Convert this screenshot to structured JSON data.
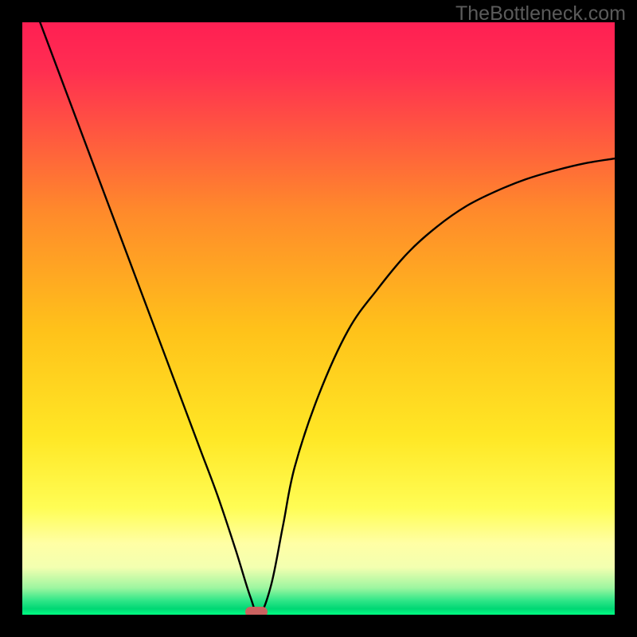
{
  "watermark": "TheBottleneck.com",
  "chart_data": {
    "type": "line",
    "title": "",
    "xlabel": "",
    "ylabel": "",
    "xlim": [
      0,
      100
    ],
    "ylim": [
      0,
      100
    ],
    "x": [
      3,
      6,
      9,
      12,
      15,
      18,
      21,
      24,
      27,
      30,
      33,
      36,
      38.5,
      40,
      42,
      44,
      46,
      50,
      55,
      60,
      65,
      70,
      75,
      80,
      85,
      90,
      95,
      100
    ],
    "values": [
      100,
      92,
      84,
      76,
      68,
      60,
      52,
      44,
      36,
      28,
      20,
      11,
      3,
      0,
      5,
      15,
      25,
      37,
      48,
      55,
      61,
      65.5,
      69,
      71.5,
      73.5,
      75,
      76.2,
      77
    ],
    "grid": false,
    "gradient": {
      "top": "#ff1f53",
      "mid": "#ffd400",
      "bottom_yellow": "#ffff6a",
      "green_dark": "#00b351",
      "green_light": "#00ff83"
    },
    "marker": {
      "x": 39.5,
      "y": 0,
      "color": "#cb6260"
    }
  }
}
